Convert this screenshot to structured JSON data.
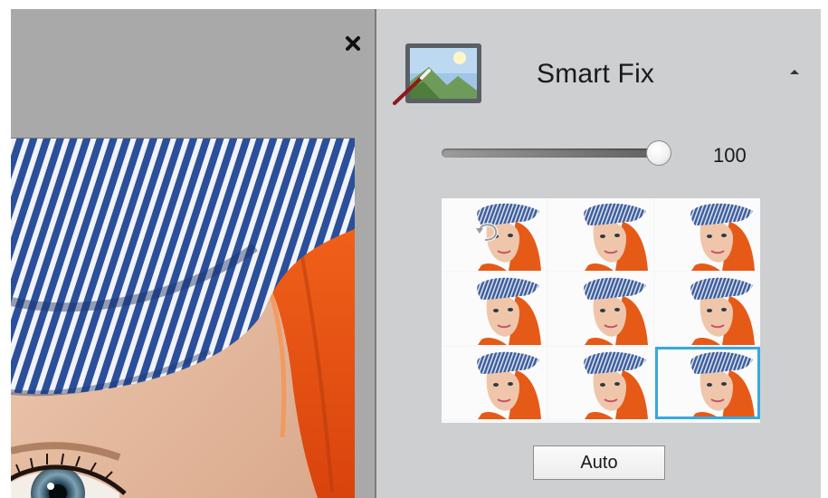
{
  "panel": {
    "title": "Smart Fix",
    "icon": "smart-fix-icon",
    "collapse_icon": "collapse-arrow-icon"
  },
  "slider": {
    "value": "100",
    "max": 100
  },
  "thumbnails": {
    "rows": 3,
    "columns": 3,
    "selected_index": 8,
    "reset_icon": "reset-icon"
  },
  "auto_button": {
    "label": "Auto"
  },
  "close_icon": "close-icon",
  "colors": {
    "panel_bg": "#cecfd1",
    "left_bg": "#a9a9a9",
    "selection": "#35a9de"
  }
}
